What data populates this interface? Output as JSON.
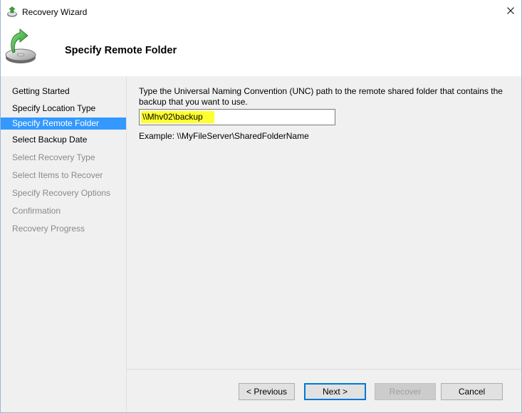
{
  "window": {
    "title": "Recovery Wizard"
  },
  "header": {
    "title": "Specify Remote Folder",
    "icon": "backup-disk-green-arrow-icon"
  },
  "nav": {
    "items": [
      {
        "label": "Getting Started",
        "state": "enabled"
      },
      {
        "label": "Specify Location Type",
        "state": "enabled"
      },
      {
        "label": "Specify Remote Folder",
        "state": "active"
      },
      {
        "label": "Select Backup Date",
        "state": "enabled"
      },
      {
        "label": "Select Recovery Type",
        "state": "disabled"
      },
      {
        "label": "Select Items to Recover",
        "state": "disabled"
      },
      {
        "label": "Specify Recovery Options",
        "state": "disabled"
      },
      {
        "label": "Confirmation",
        "state": "disabled"
      },
      {
        "label": "Recovery Progress",
        "state": "disabled"
      }
    ]
  },
  "main": {
    "instructions": "Type the Universal Naming Convention (UNC) path to the remote shared folder that contains the backup that you want to use.",
    "path_value": "\\\\Mhv02\\backup",
    "example": "Example: \\\\MyFileServer\\SharedFolderName"
  },
  "buttons": {
    "previous": "< Previous",
    "next": "Next >",
    "recover": "Recover",
    "cancel": "Cancel"
  },
  "colors": {
    "selection": "#3399ff",
    "highlight": "#ffff30",
    "pane_background": "#f0f0f0",
    "default_button_border": "#0078d7"
  }
}
